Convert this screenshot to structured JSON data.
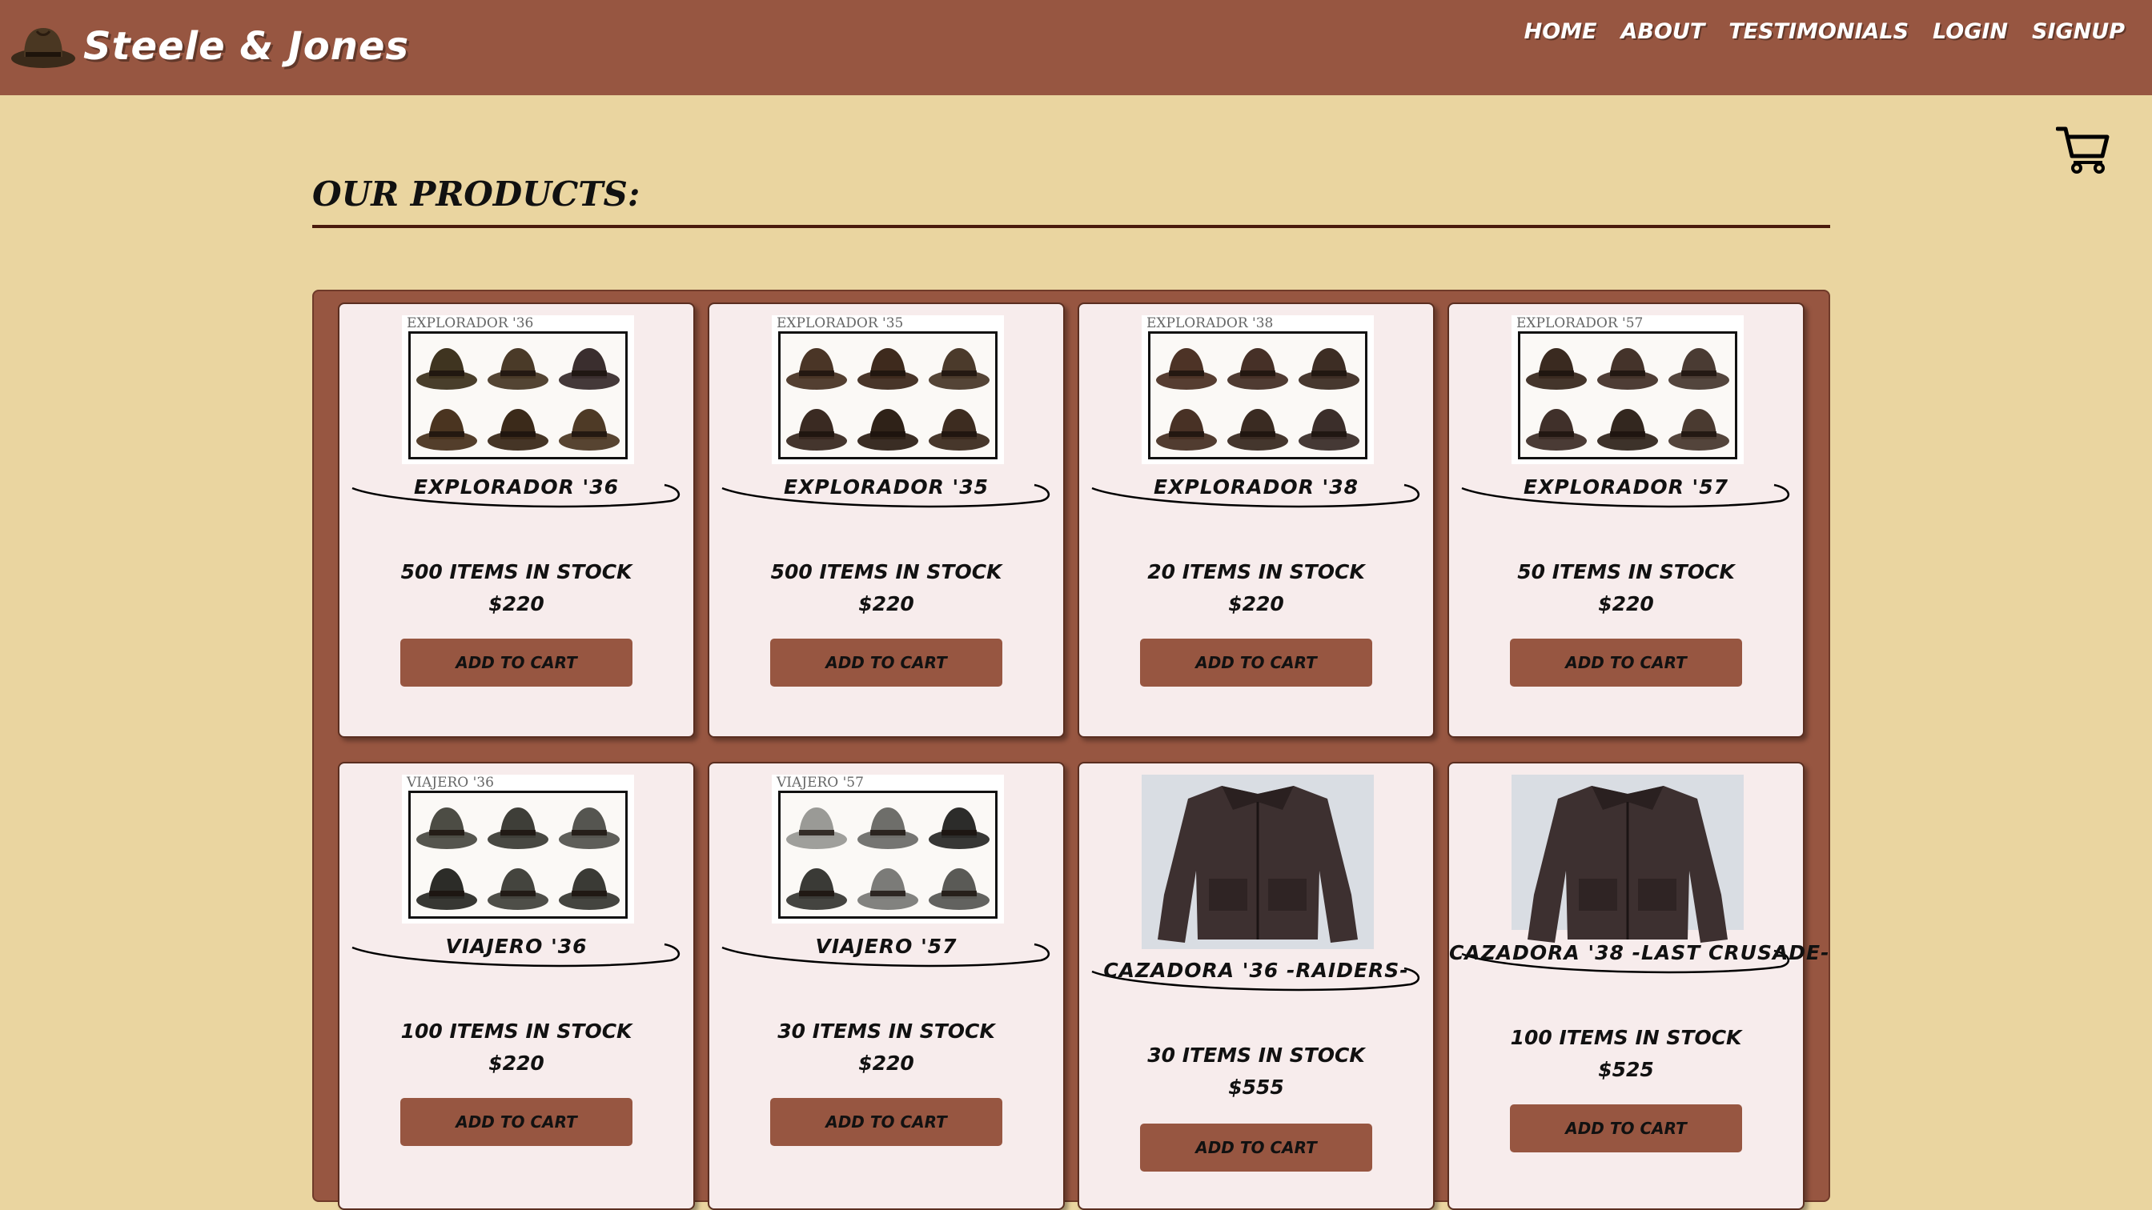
{
  "brand": {
    "name": "Steele & Jones",
    "logo_icon": "fedora-hat-icon"
  },
  "nav": [
    "HOME",
    "ABOUT",
    "TESTIMONIALS",
    "LOGIN",
    "SIGNUP"
  ],
  "cart_icon": "shopping-cart-icon",
  "heading": "OUR PRODUCTS:",
  "colors": {
    "header": "#975641",
    "background": "#ead5a0",
    "card": "#f7ecec",
    "button": "#975641"
  },
  "products": [
    {
      "caption": "EXPLORADOR '36",
      "name": "EXPLORADOR '36",
      "stock": "500 ITEMS IN STOCK",
      "price": "$220",
      "button": "ADD TO CART",
      "image": "hat-grid"
    },
    {
      "caption": "EXPLORADOR '35",
      "name": "EXPLORADOR '35",
      "stock": "500 ITEMS IN STOCK",
      "price": "$220",
      "button": "ADD TO CART",
      "image": "hat-grid"
    },
    {
      "caption": "EXPLORADOR '38",
      "name": "EXPLORADOR '38",
      "stock": "20 ITEMS IN STOCK",
      "price": "$220",
      "button": "ADD TO CART",
      "image": "hat-grid"
    },
    {
      "caption": "EXPLORADOR '57",
      "name": "EXPLORADOR '57",
      "stock": "50 ITEMS IN STOCK",
      "price": "$220",
      "button": "ADD TO CART",
      "image": "hat-grid"
    },
    {
      "caption": "VIAJERO '36",
      "name": "VIAJERO '36",
      "stock": "100 ITEMS IN STOCK",
      "price": "$220",
      "button": "ADD TO CART",
      "image": "hat-grid"
    },
    {
      "caption": "VIAJERO '57",
      "name": "VIAJERO '57",
      "stock": "30 ITEMS IN STOCK",
      "price": "$220",
      "button": "ADD TO CART",
      "image": "hat-grid"
    },
    {
      "caption": "",
      "name": "CAZADORA '36 -RAIDERS-",
      "stock": "30 ITEMS IN STOCK",
      "price": "$555",
      "button": "ADD TO CART",
      "image": "leather-jacket"
    },
    {
      "caption": "",
      "name": "CAZADORA '38 -LAST CRUSADE-",
      "stock": "100 ITEMS IN STOCK",
      "price": "$525",
      "button": "ADD TO CART",
      "image": "leather-jacket"
    }
  ]
}
